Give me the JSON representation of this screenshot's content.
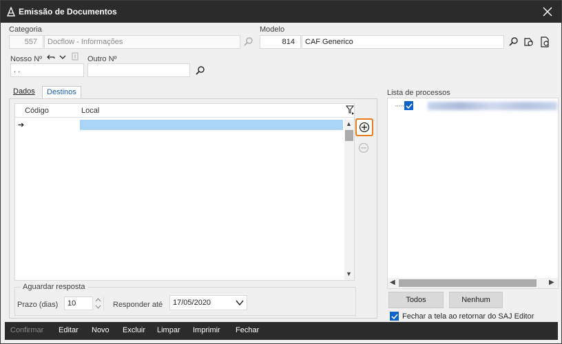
{
  "window": {
    "title": "Emissão de Documentos"
  },
  "categoria": {
    "label": "Categoria",
    "code": "557",
    "name": "Docflow - Informações"
  },
  "modelo": {
    "label": "Modelo",
    "code": "814",
    "name": "CAF Generico"
  },
  "nosso_numero": {
    "label": "Nosso Nº",
    "value": ". ."
  },
  "outro_numero": {
    "label": "Outro Nº",
    "value": ""
  },
  "tabs": [
    {
      "label": "Dados"
    },
    {
      "label": "Destinos"
    }
  ],
  "grid": {
    "col_codigo": "Código",
    "col_local": "Local",
    "row_indicator": "➔"
  },
  "aguardar": {
    "legend": "Aguardar resposta",
    "prazo_label": "Prazo (dias)",
    "prazo_value": "10",
    "responder_label": "Responder até",
    "responder_value": "17/05/2020"
  },
  "processos": {
    "label": "Lista de processos",
    "todos": "Todos",
    "nenhum": "Nenhum",
    "fechar_tela": "Fechar a tela ao retornar do SAJ Editor"
  },
  "actions": {
    "confirmar": "Confirmar",
    "editar": "Editar",
    "novo": "Novo",
    "excluir": "Excluir",
    "limpar": "Limpar",
    "imprimir": "Imprimir",
    "fechar": "Fechar"
  },
  "colors": {
    "accent": "#0a64c8",
    "highlight": "#e87b1c",
    "selection": "#a8d4f5",
    "titlebar": "#2b2b2b"
  },
  "icons": [
    "app-logo-icon",
    "close-icon",
    "search-icon",
    "search-tag-icon",
    "search-doc-icon",
    "undo-icon",
    "chevron-down-icon",
    "filter-icon",
    "add-circle-icon",
    "remove-circle-icon"
  ]
}
